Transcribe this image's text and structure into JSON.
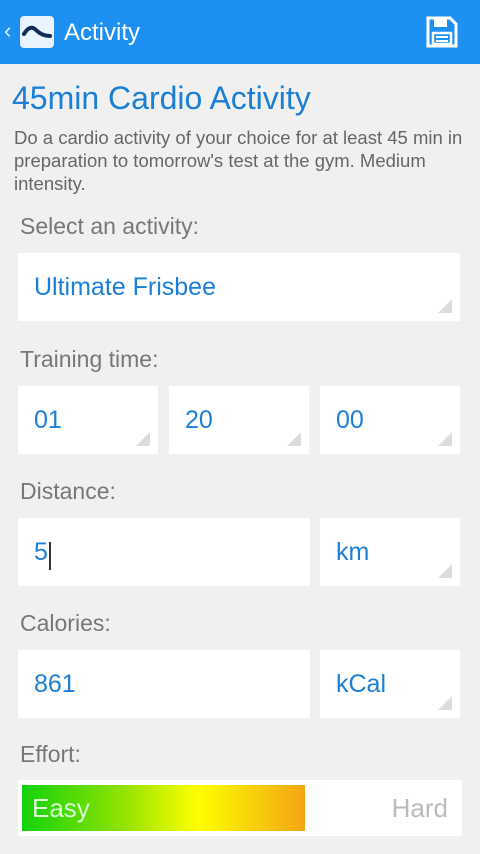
{
  "header": {
    "title": "Activity"
  },
  "activity": {
    "title": "45min Cardio Activity",
    "description": "Do a cardio activity of your choice for at least 45 min in preparation to tomorrow's test at the gym. Medium intensity."
  },
  "form": {
    "activity_label": "Select an activity:",
    "activity_value": "Ultimate Frisbee",
    "time_label": "Training time:",
    "time_hours": "01",
    "time_minutes": "20",
    "time_seconds": "00",
    "distance_label": "Distance:",
    "distance_value": "5",
    "distance_unit": "km",
    "calories_label": "Calories:",
    "calories_value": "861",
    "calories_unit": "kCal",
    "effort_label": "Effort:",
    "effort_min": "Easy",
    "effort_max": "Hard",
    "effort_level": 0.65
  },
  "colors": {
    "topbar": "#1e90f2",
    "accent": "#1b7fd6",
    "background": "#f0f0f0"
  },
  "icons": {
    "back": "chevron-left-icon",
    "logo": "app-logo-icon",
    "save": "floppy-disk-icon"
  }
}
